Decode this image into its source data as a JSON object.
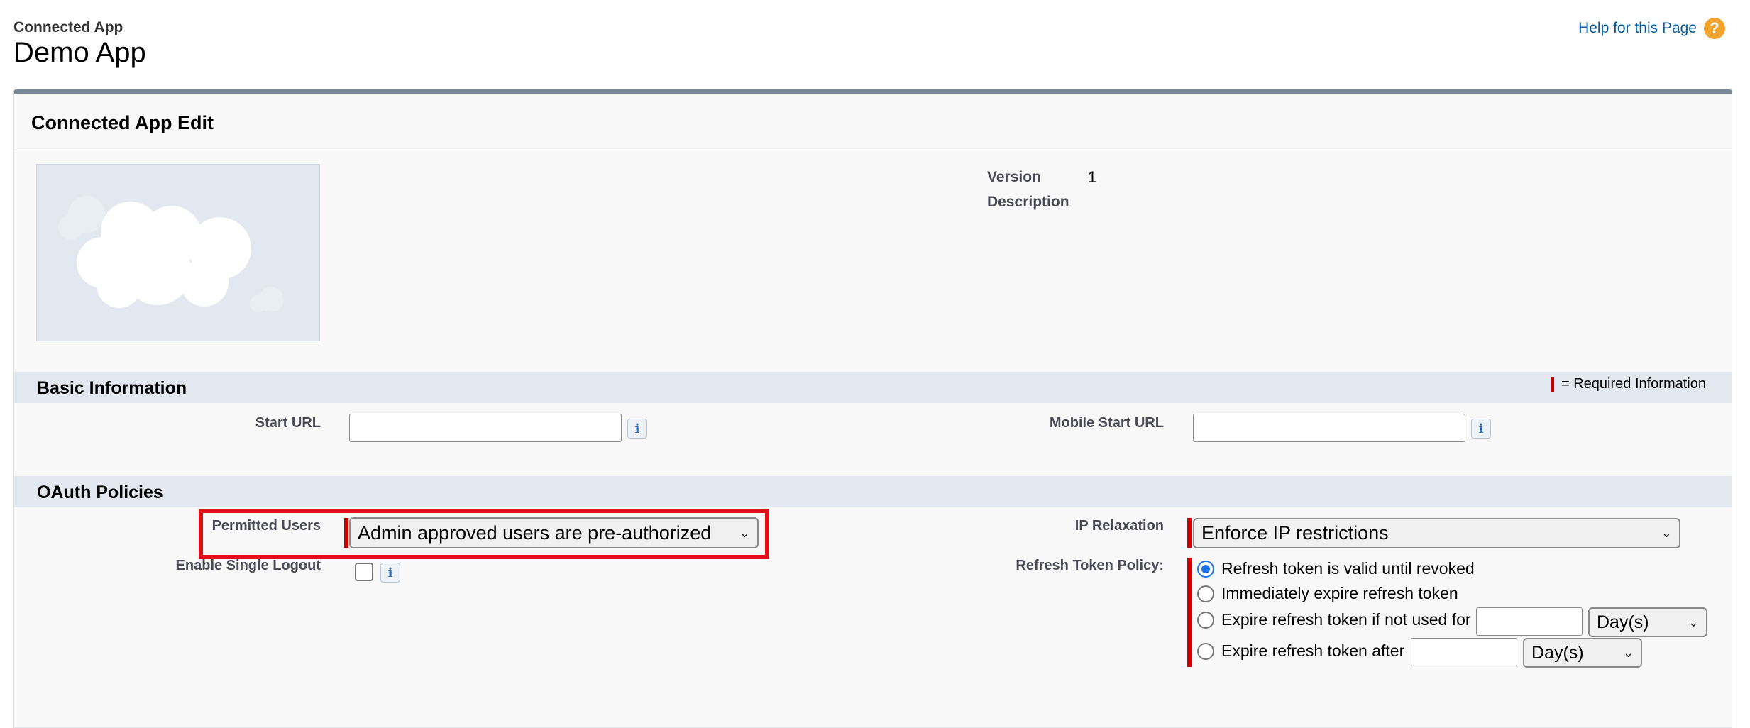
{
  "header": {
    "page_type": "Connected App",
    "page_title": "Demo App",
    "help_link": "Help for this Page",
    "help_icon": "?"
  },
  "panel": {
    "title": "Connected App Edit"
  },
  "meta": {
    "version_label": "Version",
    "version_value": "1",
    "description_label": "Description"
  },
  "basic_info": {
    "title": "Basic Information",
    "required_legend": "= Required Information",
    "start_url_label": "Start URL",
    "start_url_value": "",
    "mobile_start_url_label": "Mobile Start URL",
    "mobile_start_url_value": ""
  },
  "oauth": {
    "title": "OAuth Policies",
    "permitted_users_label": "Permitted Users",
    "permitted_users_value": "Admin approved users are pre-authorized",
    "enable_single_logout_label": "Enable Single Logout",
    "ip_relaxation_label": "IP Relaxation",
    "ip_relaxation_value": "Enforce IP restrictions",
    "refresh_token_label": "Refresh Token Policy:",
    "refresh_options": [
      "Refresh token is valid until revoked",
      "Immediately expire refresh token",
      "Expire refresh token if not used for",
      "Expire refresh token after"
    ],
    "selected_option": 0,
    "unit_not_used": "Day(s)",
    "unit_after": "Day(s)"
  },
  "info_icon_glyph": "i",
  "chevron_glyph": "⌄"
}
